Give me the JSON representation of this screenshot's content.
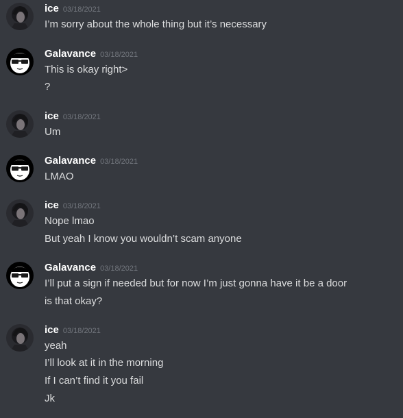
{
  "colors": {
    "background": "#36393f",
    "author": "#ffffff",
    "timestamp": "#72767d",
    "text": "#dcddde"
  },
  "messages": [
    {
      "author": "ice",
      "avatar": "dark-haired-character-avatar",
      "timestamp": "03/18/2021",
      "lines": [
        "I’m sorry about the whole thing but it’s necessary"
      ]
    },
    {
      "author": "Galavance",
      "avatar": "sunglasses-face-avatar",
      "timestamp": "03/18/2021",
      "lines": [
        "This is okay right>",
        "?"
      ]
    },
    {
      "author": "ice",
      "avatar": "dark-haired-character-avatar",
      "timestamp": "03/18/2021",
      "lines": [
        "Um"
      ]
    },
    {
      "author": "Galavance",
      "avatar": "sunglasses-face-avatar",
      "timestamp": "03/18/2021",
      "lines": [
        "LMAO"
      ]
    },
    {
      "author": "ice",
      "avatar": "dark-haired-character-avatar",
      "timestamp": "03/18/2021",
      "lines": [
        "Nope lmao",
        "But yeah I know you wouldn’t scam anyone"
      ]
    },
    {
      "author": "Galavance",
      "avatar": "sunglasses-face-avatar",
      "timestamp": "03/18/2021",
      "lines": [
        "I’ll put a sign if needed but for now I’m just gonna have it be a door",
        "is that okay?"
      ]
    },
    {
      "author": "ice",
      "avatar": "dark-haired-character-avatar",
      "timestamp": "03/18/2021",
      "lines": [
        "yeah",
        "I’ll look at it in the morning",
        "If I can’t find it you fail",
        "Jk"
      ]
    }
  ]
}
